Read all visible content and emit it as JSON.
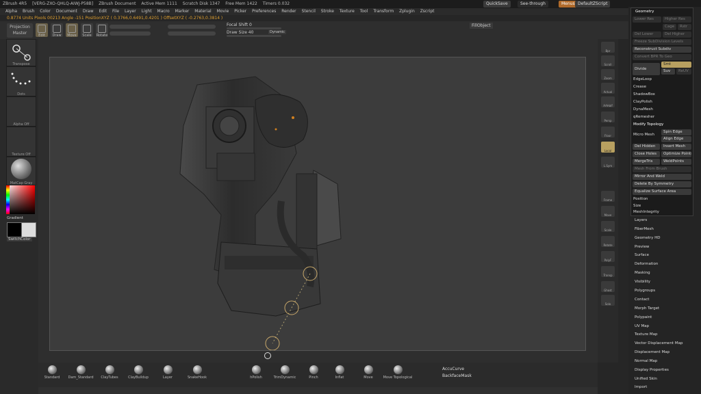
{
  "titlebar": {
    "segments": [
      "ZBrush 4R5",
      "[VERG-ZXO-QHLQ-AIWJ-P58B]",
      "ZBrush Document",
      "Active Mem 1111",
      "Scratch Disk 1347",
      "Free Mem 1422",
      "Timers 0.032"
    ],
    "quicksave": "QuickSave",
    "seethrough": "See-through",
    "menus_btn": "Menus",
    "script": "DefaultZScript"
  },
  "menubar": [
    "Alpha",
    "Brush",
    "Color",
    "Document",
    "Draw",
    "Edit",
    "File",
    "Layer",
    "Light",
    "Macro",
    "Marker",
    "Material",
    "Movie",
    "Picker",
    "Preferences",
    "Render",
    "Stencil",
    "Stroke",
    "Texture",
    "Tool",
    "Transform",
    "Zplugin",
    "Zscript"
  ],
  "infobar": "0.8774 Units     Pixols 00213  Angle -151  PositionXYZ ( 0.3766,0.6491,0.4201 )  OffsetXYZ ( -0.2763,0.3814 )",
  "toolbar": {
    "projection": "Projection Master",
    "tools": [
      "Edit",
      "Draw",
      "Move",
      "Scale",
      "Rotate"
    ],
    "focal_shift": "Focal Shift 0",
    "draw_size": "Draw Size 40",
    "dynamic": "Dynamic",
    "fill_object": "FillObject"
  },
  "leftshelf": {
    "transpose": "Transpose",
    "dots": "Dots",
    "alpha_off": "Alpha Off",
    "texture_off": "Texture Off",
    "material": "MatCap Gray",
    "gradient": "Gradient",
    "switchcolor": "SwitchColor"
  },
  "rightshelf": [
    "Bpr",
    "Scroll",
    "Zoom",
    "Actual",
    "AAHalf",
    "Persp",
    "Floor",
    "Local",
    "L.Sym",
    "Frame",
    "Move",
    "Scale",
    "Rotate",
    "PolyF",
    "Transp",
    "Ghost",
    "Solo"
  ],
  "geometry": {
    "title": "Geometry",
    "lower_res": "Lower Res",
    "higher_res": "Higher Res",
    "cage": "Cage",
    "rstr": "Rstr",
    "del_lower": "Del Lower",
    "del_higher": "Del Higher",
    "freeze": "Freeze SubDivision Levels",
    "reconstruct": "Reconstruct Subdiv",
    "convert_bpr": "Convert BPR To Geo",
    "divide": "Divide",
    "smt": "Smt",
    "suv": "Suv",
    "reuv": "ReUV",
    "subs": [
      "EdgeLoop",
      "Crease",
      "ShadowBox",
      "ClayPolish",
      "DynaMesh",
      "qRemesher"
    ],
    "modify_topology": "Modify Topology",
    "spin_edge": "Spin Edge",
    "micro_mesh": "Micro Mesh",
    "align_edge": "Align Edge",
    "del_hidden": "Del Hidden",
    "insert_mesh": "Insert Mesh",
    "close_holes": "Close Holes",
    "optimize_points": "Optimize Points",
    "merge_tris": "MergeTris",
    "weld_points": "WeldPoints",
    "mesh_from_brush": "Mesh From Brush",
    "mirror_weld": "Mirror And Weld",
    "delete_symmetry": "Delete By Symmetry",
    "equalize": "Equalize Surface Area",
    "subs2": [
      "Position",
      "Size",
      "MeshIntegrity"
    ]
  },
  "tool_menu": [
    "Layers",
    "FiberMesh",
    "Geometry HD",
    "Preview",
    "Surface",
    "Deformation",
    "Masking",
    "Visibility",
    "Polygroups",
    "Contact",
    "Morph Target",
    "Polypaint",
    "UV Map",
    "Texture Map",
    "Vector Displacement Map",
    "Displacement Map",
    "Normal Map",
    "Display Properties",
    "Unified Skin",
    "Import"
  ],
  "brushes": [
    "Standard",
    "Dam_Standard",
    "ClayTubes",
    "ClayBuildup",
    "Layer",
    "SnakeHook",
    "hPolish",
    "TrimDynamic",
    "Pinch",
    "Inflat",
    "Move",
    "Move Topological"
  ],
  "accucurve": "AccuCurve",
  "backfacemask": "BackfaceMask"
}
